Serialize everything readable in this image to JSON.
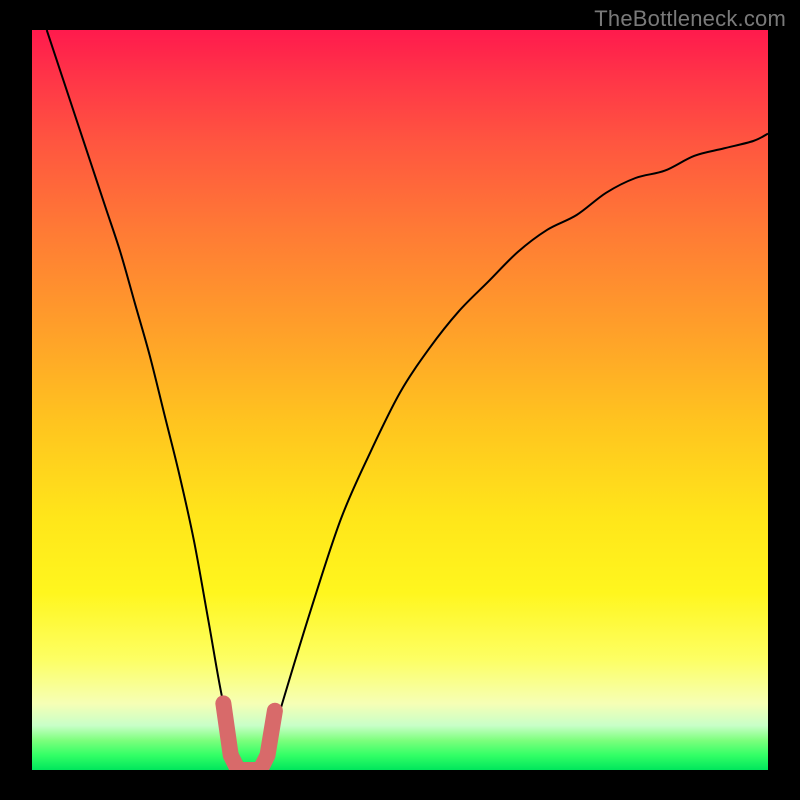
{
  "watermark": "TheBottleneck.com",
  "chart_data": {
    "type": "line",
    "title": "",
    "xlabel": "",
    "ylabel": "",
    "xlim": [
      0,
      100
    ],
    "ylim": [
      0,
      100
    ],
    "grid": false,
    "legend": false,
    "series": [
      {
        "name": "bottleneck-curve",
        "x": [
          2,
          4,
          6,
          8,
          10,
          12,
          14,
          16,
          18,
          20,
          22,
          24,
          26,
          28,
          30,
          32,
          34,
          38,
          42,
          46,
          50,
          54,
          58,
          62,
          66,
          70,
          74,
          78,
          82,
          86,
          90,
          94,
          98,
          100
        ],
        "values": [
          100,
          94,
          88,
          82,
          76,
          70,
          63,
          56,
          48,
          40,
          31,
          20,
          9,
          2,
          0,
          2,
          9,
          22,
          34,
          43,
          51,
          57,
          62,
          66,
          70,
          73,
          75,
          78,
          80,
          81,
          83,
          84,
          85,
          86
        ]
      }
    ],
    "marker": {
      "name": "optimal-range",
      "points": [
        {
          "x": 26,
          "y": 9
        },
        {
          "x": 27,
          "y": 2
        },
        {
          "x": 28,
          "y": 0
        },
        {
          "x": 31,
          "y": 0
        },
        {
          "x": 32,
          "y": 2
        },
        {
          "x": 33,
          "y": 8
        }
      ]
    },
    "background_gradient": {
      "top_color": "#ff1a4d",
      "bottom_color": "#00e65c"
    }
  }
}
